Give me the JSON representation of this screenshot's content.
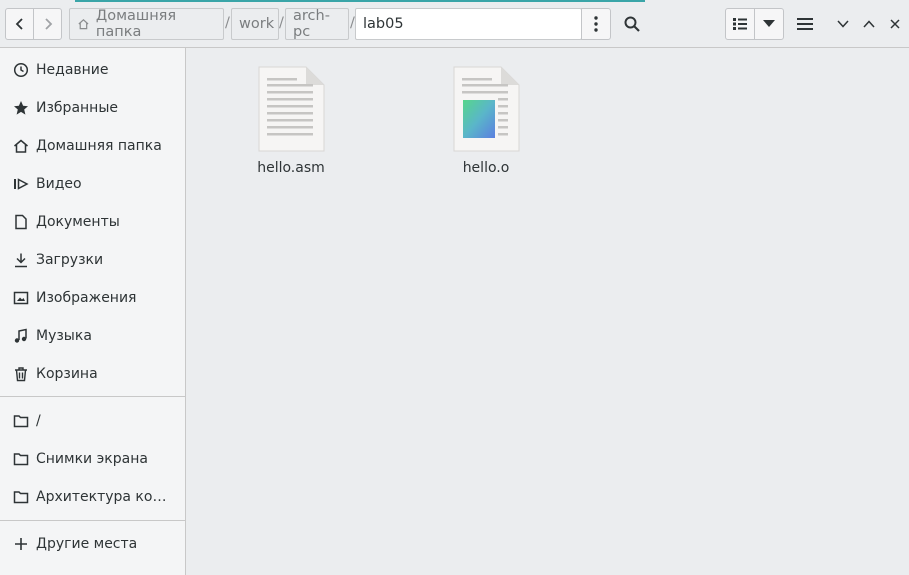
{
  "path": {
    "crumbs": [
      {
        "label": "Домашняя папка"
      },
      {
        "label": "work"
      },
      {
        "label": "arch-pc"
      },
      {
        "label": "lab05"
      }
    ],
    "separator": "/"
  },
  "sidebar": {
    "items": [
      {
        "label": "Недавние",
        "icon": "clock-icon"
      },
      {
        "label": "Избранные",
        "icon": "star-icon"
      },
      {
        "label": "Домашняя папка",
        "icon": "home-icon"
      },
      {
        "label": "Видео",
        "icon": "video-icon"
      },
      {
        "label": "Документы",
        "icon": "document-icon"
      },
      {
        "label": "Загрузки",
        "icon": "download-icon"
      },
      {
        "label": "Изображения",
        "icon": "image-icon"
      },
      {
        "label": "Музыка",
        "icon": "music-icon"
      },
      {
        "label": "Корзина",
        "icon": "trash-icon"
      }
    ],
    "bookmarks": [
      {
        "label": "/",
        "icon": "folder-icon"
      },
      {
        "label": "Снимки экрана",
        "icon": "folder-icon"
      },
      {
        "label": "Архитектура компьютера",
        "icon": "folder-icon"
      }
    ],
    "other_locations": {
      "label": "Другие места",
      "icon": "plus-icon"
    }
  },
  "files": [
    {
      "name": "hello.asm",
      "icon": "text-file-icon"
    },
    {
      "name": "hello.o",
      "icon": "object-file-icon"
    }
  ],
  "colors": {
    "accent": "#3aa5a8"
  }
}
